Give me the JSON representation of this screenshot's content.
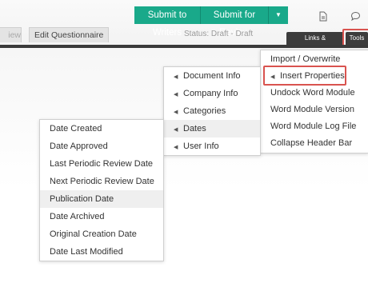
{
  "header": {
    "submit_writers": "Submit to Writers",
    "submit_review": "Submit for Review",
    "dropdown_caret": "▼",
    "file_icon": "file-icon",
    "comment_icon": "comment-icon"
  },
  "tabs": {
    "partial_tab": "iew",
    "edit_questionnaire": "Edit Questionnaire",
    "status": "Status: Draft - Draft",
    "links": "Links & Attachments",
    "tools": "Tools"
  },
  "menus": {
    "tools": {
      "items": [
        {
          "label": "Import / Overwrite",
          "has_arrow": false
        },
        {
          "label": "Insert Properties",
          "has_arrow": true,
          "highlighted": true
        },
        {
          "label": "Undock Word Module",
          "has_arrow": false
        },
        {
          "label": "Word Module Version",
          "has_arrow": false
        },
        {
          "label": "Word Module Log File",
          "has_arrow": false
        },
        {
          "label": "Collapse Header Bar",
          "has_arrow": false
        }
      ]
    },
    "properties": {
      "items": [
        {
          "label": "Document Info"
        },
        {
          "label": "Company Info"
        },
        {
          "label": "Categories"
        },
        {
          "label": "Dates",
          "highlighted": true
        },
        {
          "label": "User Info"
        }
      ]
    },
    "dates": {
      "items": [
        {
          "label": "Date Created"
        },
        {
          "label": "Date Approved"
        },
        {
          "label": "Last Periodic Review Date"
        },
        {
          "label": "Next Periodic Review Date"
        },
        {
          "label": "Publication Date",
          "highlighted": true
        },
        {
          "label": "Date Archived"
        },
        {
          "label": "Original Creation Date"
        },
        {
          "label": "Date Last Modified"
        }
      ]
    }
  },
  "colors": {
    "accent_green": "#19a98a",
    "highlight_red": "#d9534f",
    "dark_bar": "#3c3c3c"
  }
}
